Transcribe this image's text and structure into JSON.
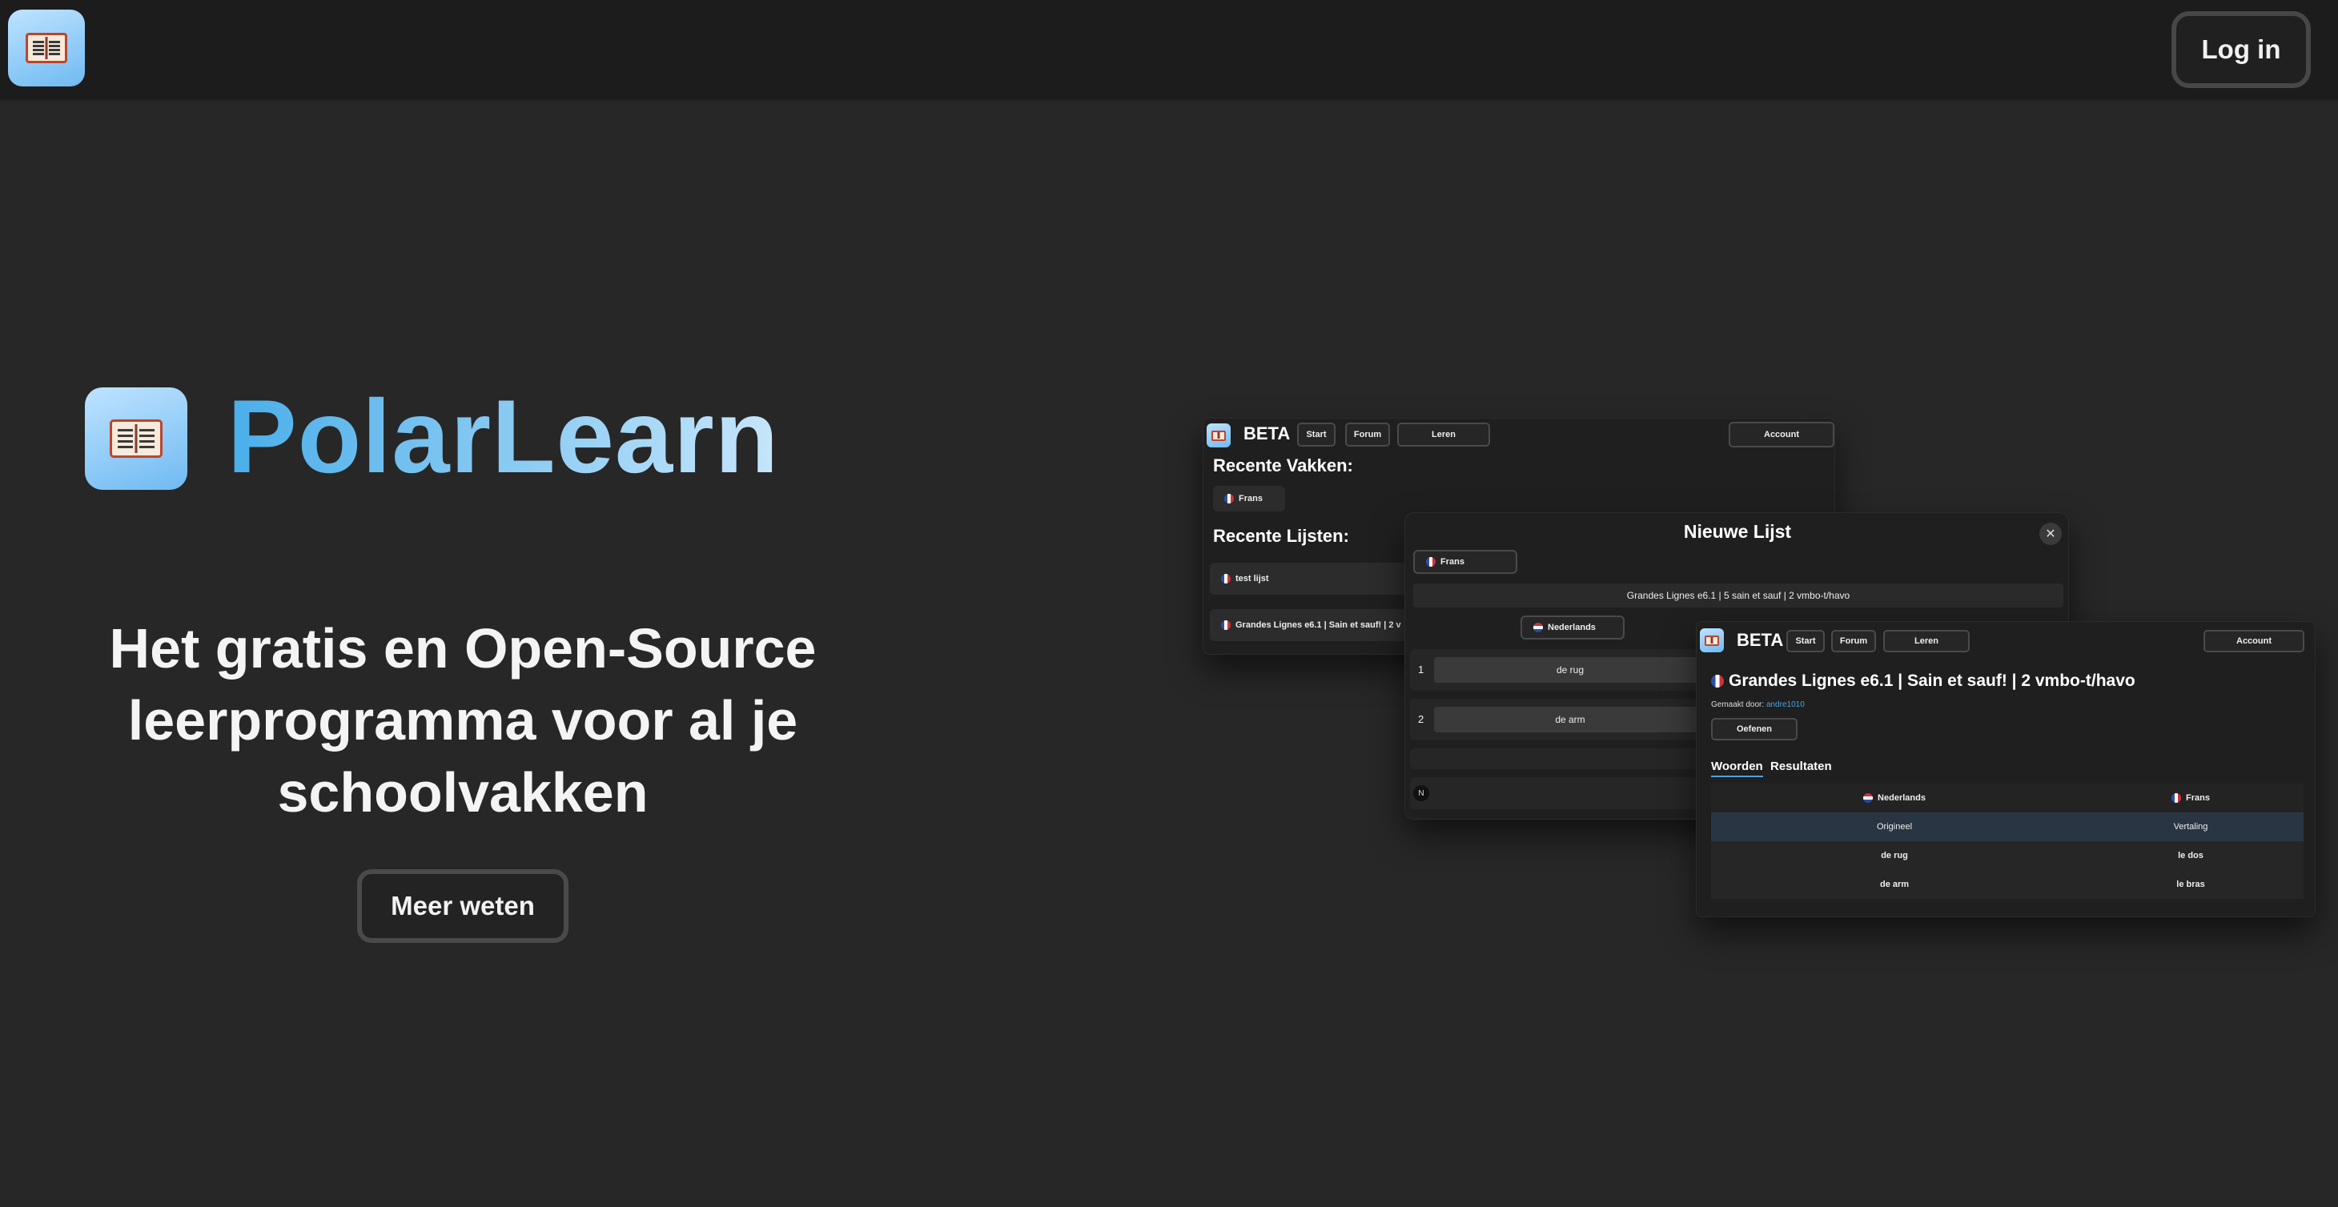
{
  "header": {
    "logo_icon": "open-book-icon",
    "login_label": "Log in"
  },
  "hero": {
    "brand": "PolarLearn",
    "headline": "Het gratis en Open-Source leerprogramma voor al je schoolvakken",
    "more_label": "Meer weten"
  },
  "preview": {
    "dashboard": {
      "beta": "BETA",
      "nav": [
        "Start",
        "Forum",
        "Leren"
      ],
      "account": "Account",
      "recent_subjects_title": "Recente Vakken:",
      "subject_chip": "Frans",
      "recent_lists_title": "Recente Lijsten:",
      "list_items": [
        "test lijst",
        "Grandes Lignes e6.1 | Sain et sauf! | 2 v"
      ]
    },
    "new_list": {
      "title": "Nieuwe Lijst",
      "subject": "Frans",
      "list_name": "Grandes Lignes e6.1 | 5 sain et sauf | 2 vmbo-t/havo",
      "language": "Nederlands",
      "rows": [
        {
          "num": "1",
          "word": "de rug"
        },
        {
          "num": "2",
          "word": "de arm"
        }
      ],
      "badge": "N"
    },
    "list_view": {
      "beta": "BETA",
      "nav": [
        "Start",
        "Forum",
        "Leren"
      ],
      "account": "Account",
      "title": "Grandes Lignes e6.1 | Sain et sauf! | 2 vmbo-t/havo",
      "made_by_label": "Gemaakt door:",
      "author": "andre1010",
      "practice_label": "Oefenen",
      "tabs": [
        "Woorden",
        "Resultaten"
      ],
      "columns": [
        "Nederlands",
        "Frans"
      ],
      "rows": [
        [
          "Origineel",
          "Vertaling"
        ],
        [
          "de rug",
          "le dos"
        ],
        [
          "de arm",
          "le bras"
        ]
      ]
    }
  },
  "colors": {
    "background": "#272727",
    "topbar": "#1c1c1c",
    "brand_gradient_start": "#4aaee9",
    "brand_gradient_end": "#c6e6fb",
    "link": "#4aa3e0"
  }
}
